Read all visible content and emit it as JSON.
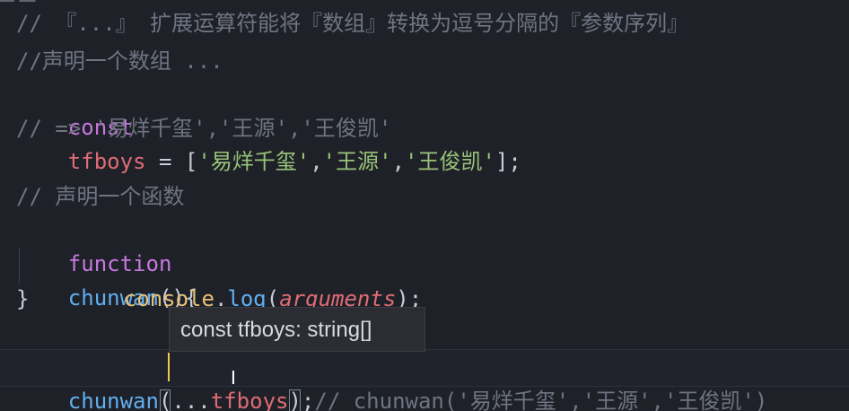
{
  "editor": {
    "lines": {
      "l1": {
        "text": "// 『...』 扩展运算符能将『数组』转换为逗号分隔的『参数序列』"
      },
      "l2": {
        "text": "//声明一个数组 ..."
      },
      "l3": {
        "keyword": "const",
        "name": "tfboys",
        "equals": " = ",
        "open": "[",
        "s1": "'易烊千玺'",
        "sep1": ",",
        "s2": "'王源'",
        "sep2": ",",
        "s3": "'王俊凯'",
        "close": "];"
      },
      "l4": {
        "text": "// => '易烊千玺','王源','王俊凯'"
      },
      "l6": {
        "text": "// 声明一个函数"
      },
      "l7": {
        "keyword": "function",
        "name": "chunwan",
        "parens": "()",
        "brace": "{"
      },
      "l8": {
        "object": "console",
        "dot": ".",
        "method": "log",
        "open": "(",
        "param": "arguments",
        "close": ");"
      },
      "l9": {
        "brace": "}"
      },
      "l11": {
        "name": "chunwan",
        "open": "(",
        "spread": "...",
        "arg": "tfboy",
        "arg_tail": "s",
        "close": ")",
        "semi": ";",
        "comment": "// chunwan('易烊千玺','王源','王俊凯')"
      }
    },
    "tooltip": {
      "text": "const tfboys: string[]"
    },
    "cursor_icon": "text-cursor-icon",
    "colors": {
      "background": "#1f2128",
      "comment": "#6f7482",
      "keyword": "#c678dd",
      "variable": "#e06c75",
      "string": "#98c379",
      "function": "#61afef",
      "object": "#e5c07b",
      "cursor": "#f2c94c"
    }
  }
}
